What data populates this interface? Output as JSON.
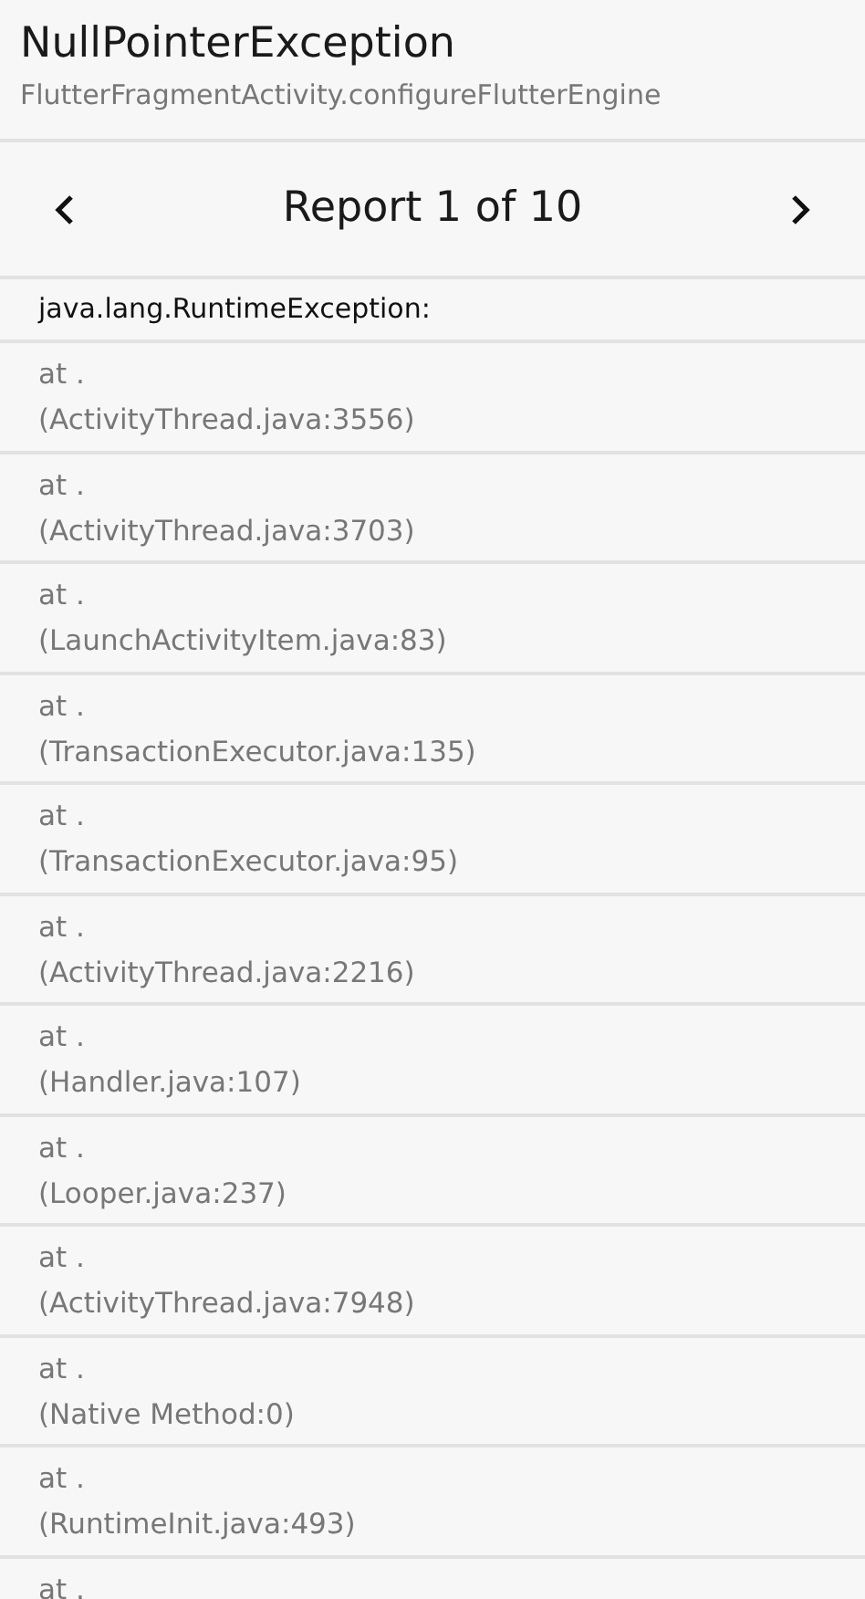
{
  "header": {
    "title": "NullPointerException",
    "subtitle": "FlutterFragmentActivity.configureFlutterEngine"
  },
  "navigator": {
    "title": "Report 1 of 10"
  },
  "exception": "java.lang.RuntimeException:",
  "frames": [
    {
      "line_1": "at .",
      "line_2": "(ActivityThread.java:3556)"
    },
    {
      "line_1": "at .",
      "line_2": "(ActivityThread.java:3703)"
    },
    {
      "line_1": "at .",
      "line_2": "(LaunchActivityItem.java:83)"
    },
    {
      "line_1": "at .",
      "line_2": "(TransactionExecutor.java:135)"
    },
    {
      "line_1": "at .",
      "line_2": "(TransactionExecutor.java:95)"
    },
    {
      "line_1": "at .",
      "line_2": "(ActivityThread.java:2216)"
    },
    {
      "line_1": "at .",
      "line_2": "(Handler.java:107)"
    },
    {
      "line_1": "at .",
      "line_2": "(Looper.java:237)"
    },
    {
      "line_1": "at .",
      "line_2": "(ActivityThread.java:7948)"
    },
    {
      "line_1": "at .",
      "line_2": "(Native Method:0)"
    },
    {
      "line_1": "at .",
      "line_2": "(RuntimeInit.java:493)"
    },
    {
      "line_1": "at ."
    }
  ]
}
